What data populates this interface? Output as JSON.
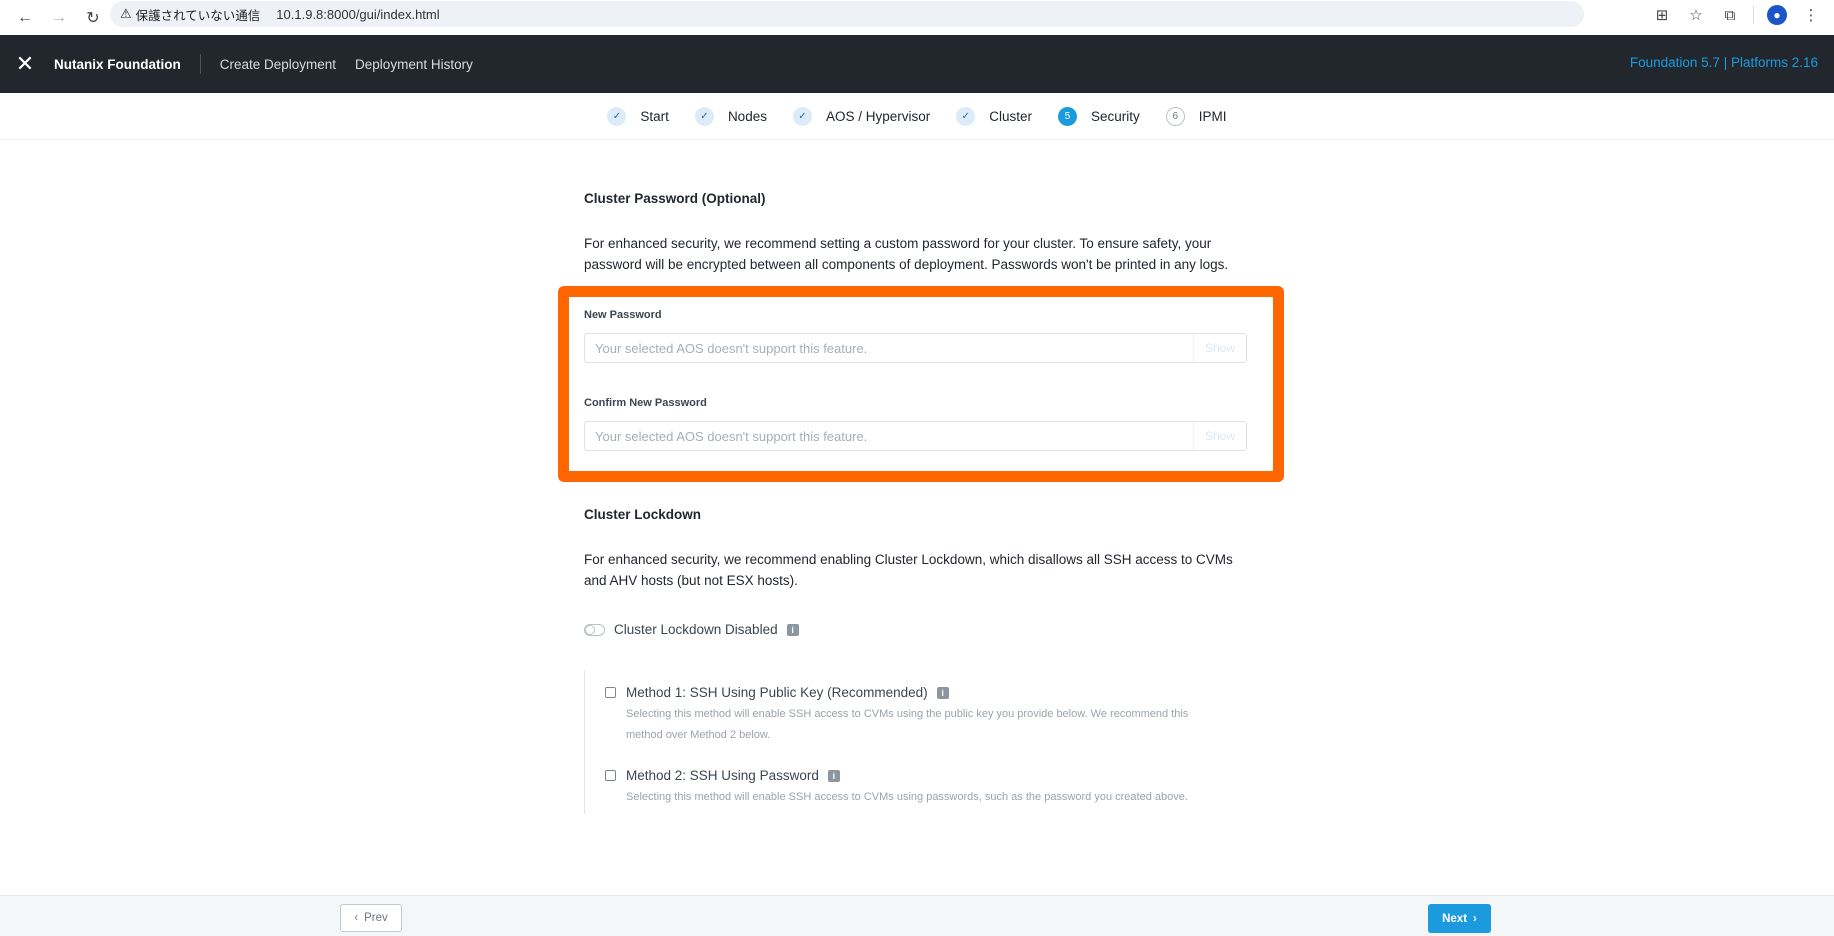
{
  "browser": {
    "security_warning": "保護されていない通信",
    "url": "10.1.9.8:8000/gui/index.html"
  },
  "header": {
    "brand": "Nutanix Foundation",
    "nav": [
      "Create Deployment",
      "Deployment History"
    ],
    "version": "Foundation 5.7 | Platforms 2.16"
  },
  "stepper": {
    "steps": [
      {
        "label": "Start",
        "state": "done",
        "marker": "✓"
      },
      {
        "label": "Nodes",
        "state": "done",
        "marker": "✓"
      },
      {
        "label": "AOS / Hypervisor",
        "state": "done",
        "marker": "✓"
      },
      {
        "label": "Cluster",
        "state": "done",
        "marker": "✓"
      },
      {
        "label": "Security",
        "state": "active",
        "marker": "5"
      },
      {
        "label": "IPMI",
        "state": "todo",
        "marker": "6"
      }
    ]
  },
  "password": {
    "title": "Cluster Password (Optional)",
    "description": "For enhanced security, we recommend setting a custom password for your cluster. To ensure safety, your password will be encrypted between all components of deployment. Passwords won't be printed in any logs.",
    "new_label": "New Password",
    "confirm_label": "Confirm New Password",
    "placeholder": "Your selected AOS doesn't support this feature.",
    "show_label": "Show"
  },
  "lockdown": {
    "title": "Cluster Lockdown",
    "description": "For enhanced security, we recommend enabling Cluster Lockdown, which disallows all SSH access to CVMs and AHV hosts (but not ESX hosts).",
    "toggle_label": "Cluster Lockdown Disabled",
    "method1_title": "Method 1: SSH Using Public Key (Recommended)",
    "method1_desc_line1": "Selecting this method will enable SSH access to CVMs using the public key you provide below. We recommend this",
    "method1_desc_line2": "method over Method 2 below.",
    "method2_title": "Method 2: SSH Using Password",
    "method2_desc": "Selecting this method will enable SSH access to CVMs using passwords, such as the password you created above."
  },
  "footer": {
    "prev_label": "Prev",
    "next_label": "Next"
  },
  "colors": {
    "accent": "#1b9bde",
    "header_bg": "#22272e",
    "highlight": "#ff6600"
  }
}
